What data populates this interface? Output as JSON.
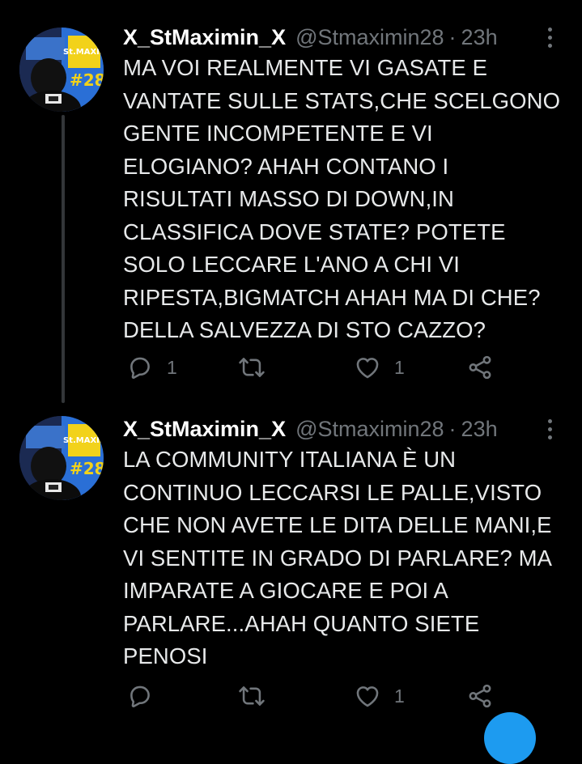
{
  "colors": {
    "background": "#000000",
    "text_primary": "#e7e9ea",
    "text_secondary": "#71767b",
    "thread_line": "#333639",
    "accent": "#1d9bf0"
  },
  "tweets": [
    {
      "display_name": "X_StMaximin_X",
      "handle": "@Stmaximin28",
      "separator": "·",
      "time": "23h",
      "lines": [
        "MA VOI REALMENTE VI GASATE E",
        "VANTATE SULLE STATS,CHE SCELGONO",
        "GENTE INCOMPETENTE E VI",
        "ELOGIANO? AHAH CONTANO I",
        "RISULTATI MASSO DI DOWN,IN",
        "CLASSIFICA DOVE STATE? POTETE",
        "SOLO LECCARE L'ANO A CHI VI",
        "RIPESTA,BIGMATCH AHAH MA DI CHE?",
        "DELLA SALVEZZA DI STO CAZZO?"
      ],
      "reply_count": "1",
      "retweet_count": "",
      "like_count": "1",
      "icons": {
        "reply": "reply-icon",
        "retweet": "retweet-icon",
        "like": "heart-icon",
        "share": "share-icon",
        "more": "more-vertical-icon"
      }
    },
    {
      "display_name": "X_StMaximin_X",
      "handle": "@Stmaximin28",
      "separator": "·",
      "time": "23h",
      "lines": [
        "LA COMMUNITY ITALIANA È UN",
        "CONTINUO LECCARSI LE PALLE,VISTO",
        "CHE NON AVETE LE DITA DELLE MANI,E",
        "VI SENTITE IN GRADO DI PARLARE? MA",
        "IMPARATE A GIOCARE E POI A",
        "PARLARE...AHAH QUANTO SIETE",
        "PENOSI"
      ],
      "reply_count": "",
      "retweet_count": "",
      "like_count": "1",
      "icons": {
        "reply": "reply-icon",
        "retweet": "retweet-icon",
        "like": "heart-icon",
        "share": "share-icon",
        "more": "more-vertical-icon"
      }
    }
  ],
  "avatar": {
    "logo_text": "St.MAXIMIN",
    "number_text": "#28",
    "icon": "profile-avatar"
  }
}
